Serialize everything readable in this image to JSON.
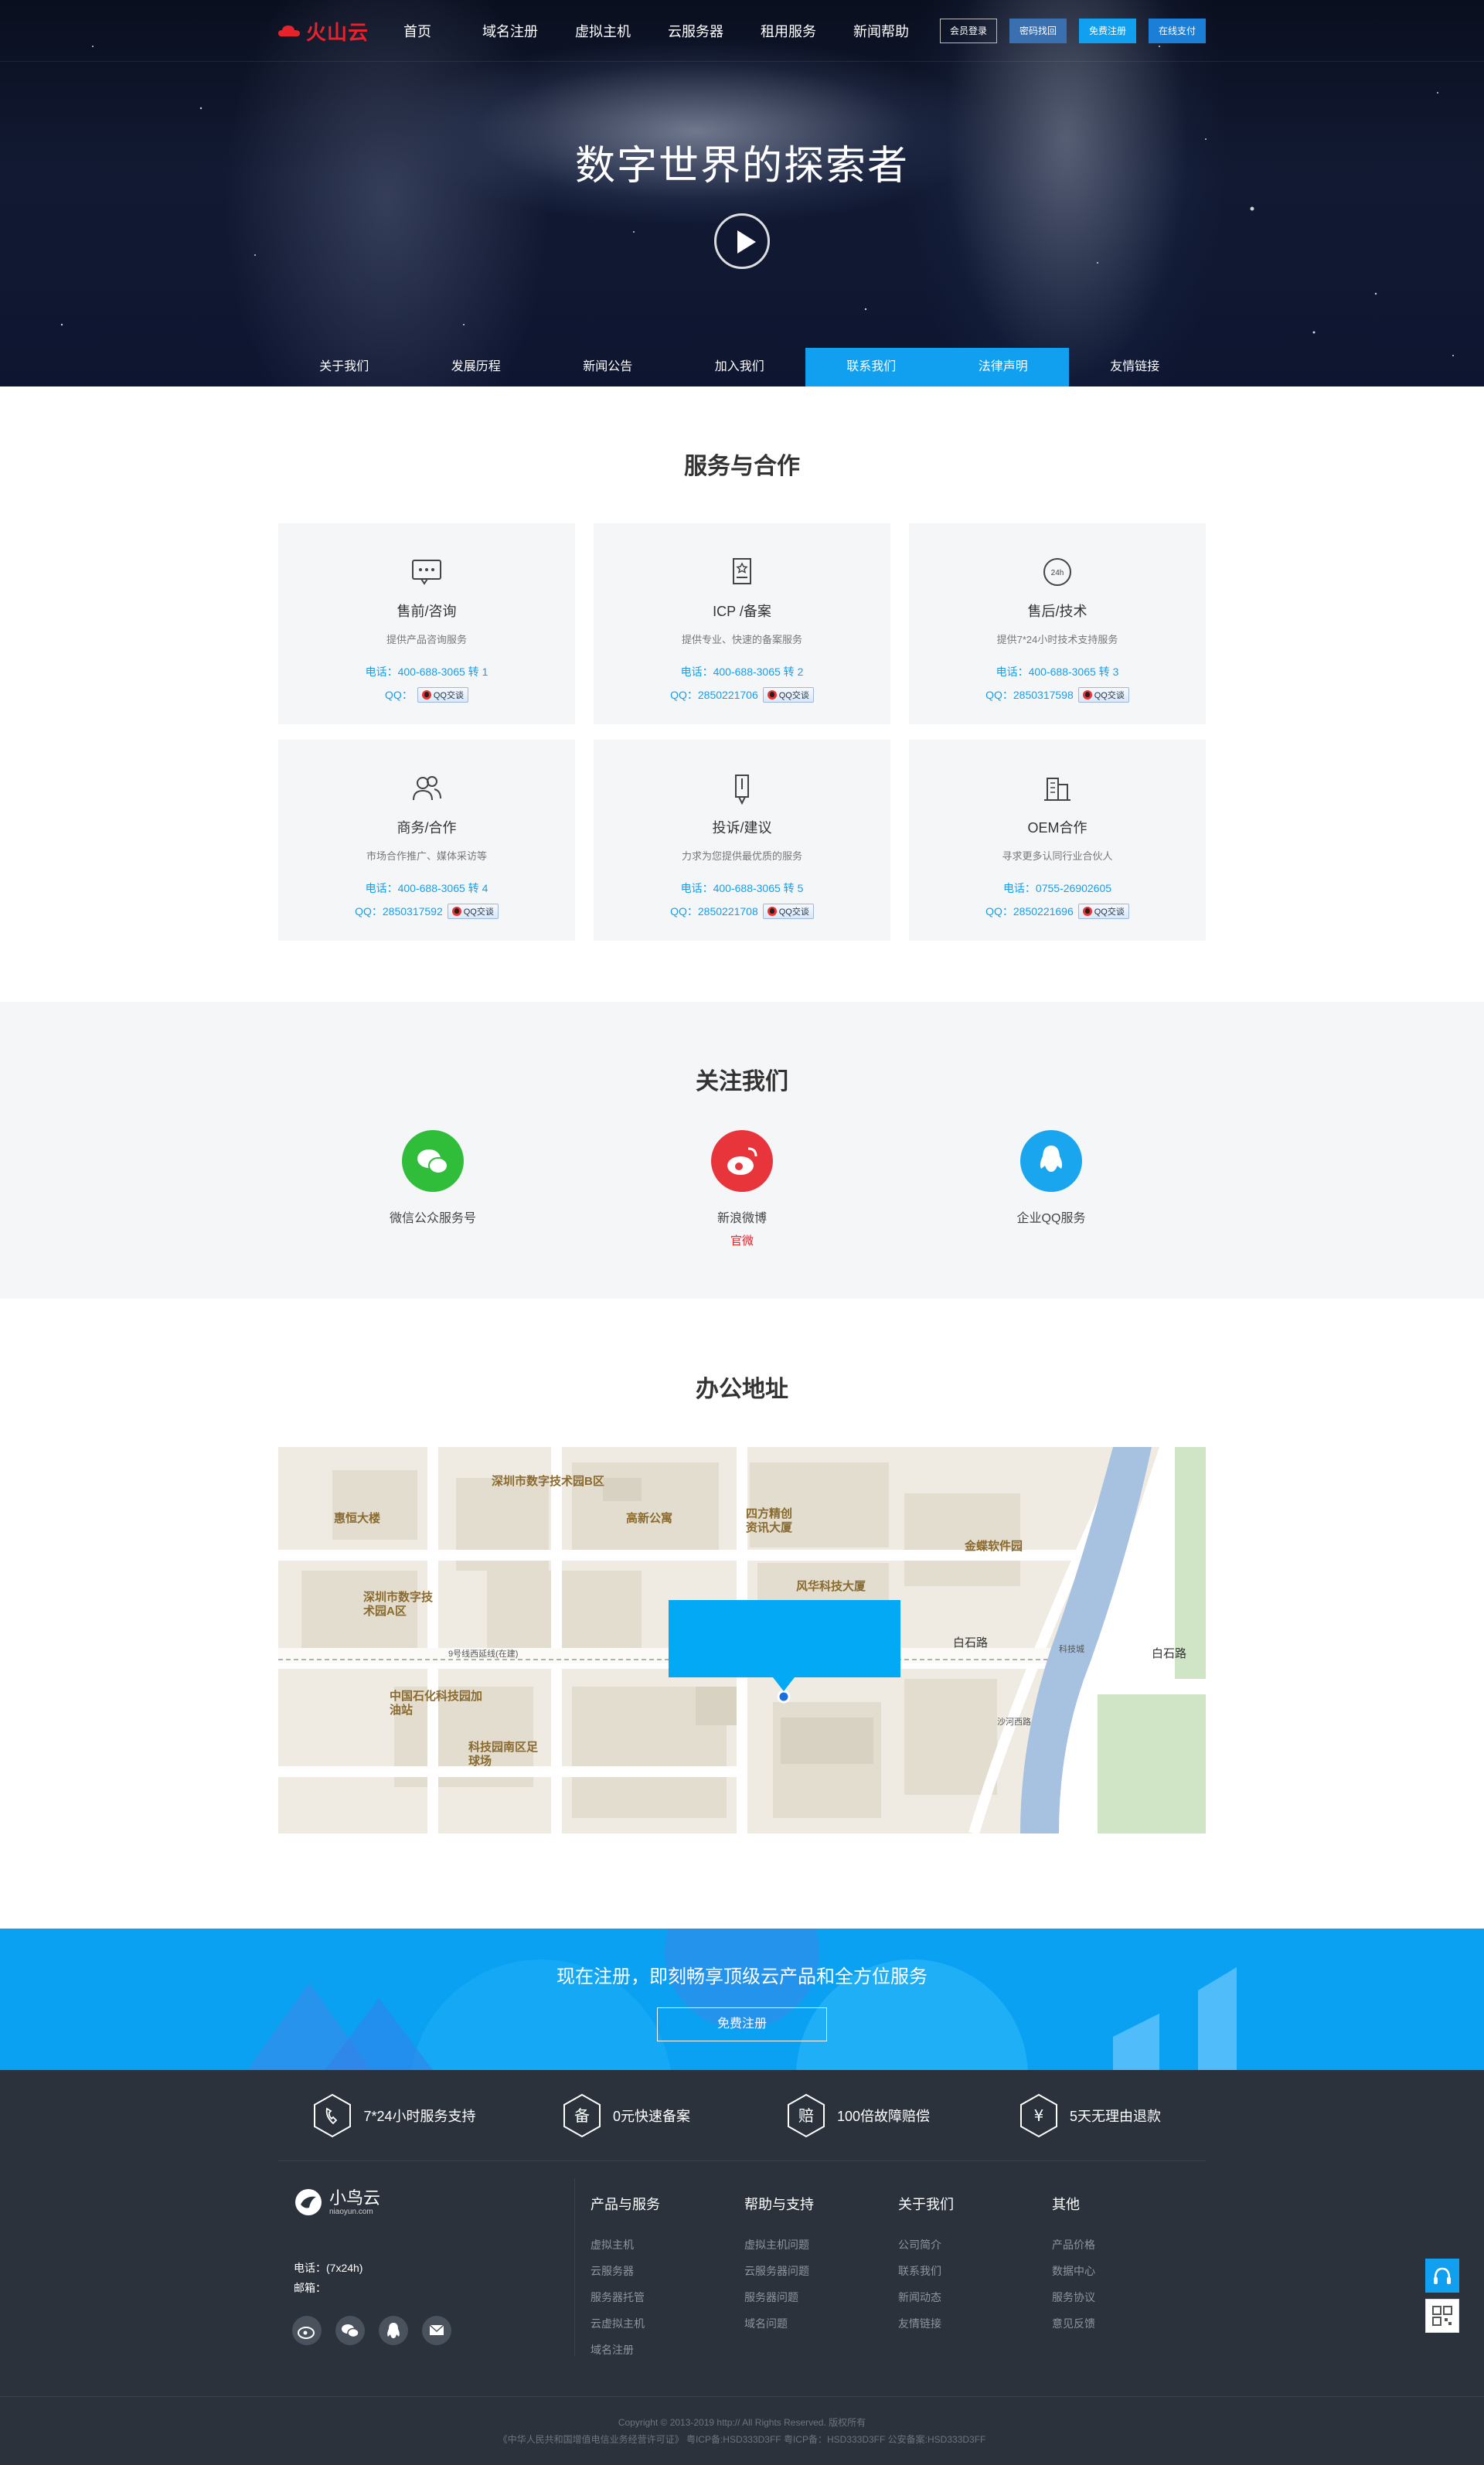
{
  "header": {
    "logo_text": "火山云",
    "nav": [
      "首页",
      "域名注册",
      "虚拟主机",
      "云服务器",
      "租用服务",
      "新闻帮助"
    ],
    "buttons": {
      "login": "会员登录",
      "find_password": "密码找回",
      "register": "免费注册",
      "pay": "在线支付"
    }
  },
  "hero": {
    "title": "数字世界的探索者",
    "subnav": [
      "关于我们",
      "发展历程",
      "新闻公告",
      "加入我们",
      "联系我们",
      "法律声明",
      "友情链接"
    ],
    "active_subnav": [
      "联系我们",
      "法律声明"
    ]
  },
  "service": {
    "title": "服务与合作",
    "qq_button": "QQ交谈",
    "cards": [
      {
        "icon": "chat-bubble-icon",
        "name": "售前/咨询",
        "desc": "提供产品咨询服务",
        "phone": "电话：400-688-3065 转 1",
        "qq_prefix": "QQ："
      },
      {
        "icon": "certificate-icon",
        "name": "ICP /备案",
        "desc": "提供专业、快速的备案服务",
        "phone": "电话：400-688-3065 转 2",
        "qq_prefix": "QQ：2850221706"
      },
      {
        "icon": "24h-clock-icon",
        "name": "售后/技术",
        "desc": "提供7*24小时技术支持服务",
        "phone": "电话：400-688-3065 转 3",
        "qq_prefix": "QQ：2850317598"
      },
      {
        "icon": "users-icon",
        "name": "商务/合作",
        "desc": "市场合作推广、媒体采访等",
        "phone": "电话：400-688-3065 转 4",
        "qq_prefix": "QQ：2850317592"
      },
      {
        "icon": "pen-icon",
        "name": "投诉/建议",
        "desc": "力求为您提供最优质的服务",
        "phone": "电话：400-688-3065 转 5",
        "qq_prefix": "QQ：2850221708"
      },
      {
        "icon": "building-icon",
        "name": "OEM合作",
        "desc": "寻求更多认同行业合伙人",
        "phone": "电话：0755-26902605",
        "qq_prefix": "QQ：2850221696"
      }
    ]
  },
  "follow": {
    "title": "关注我们",
    "items": [
      {
        "icon": "wechat-icon",
        "label": "微信公众服务号",
        "sub": "",
        "color": "#2fbd3a"
      },
      {
        "icon": "weibo-icon",
        "label": "新浪微博",
        "sub": "官微",
        "color": "#e8353b"
      },
      {
        "icon": "qq-icon",
        "label": "企业QQ服务",
        "sub": "",
        "color": "#1aa6ee"
      }
    ]
  },
  "office": {
    "title": "办公地址",
    "map_labels": {
      "a": "深圳市数字技术园B区",
      "b": "高新公寓",
      "c": "四方精创资讯大厦",
      "d": "惠恒大楼",
      "e": "金蝶软件园",
      "f": "深圳市数字技术园A区",
      "g": "风华科技大厦",
      "h": "中国石化科技园加油站",
      "i": "科技园南区足球场",
      "j": "白石路",
      "k": "白石路",
      "l": "9号线西延线(在建)",
      "m": "科技城",
      "n": "沙河西路"
    }
  },
  "cta": {
    "title": "现在注册，即刻畅享顶级云产品和全方位服务",
    "button": "免费注册"
  },
  "footer": {
    "guarantees": [
      {
        "icon": "phone-icon",
        "glyph": "",
        "text": "7*24小时服务支持"
      },
      {
        "icon": "record-icon",
        "glyph": "备",
        "text": "0元快速备案"
      },
      {
        "icon": "compensation-icon",
        "glyph": "赔",
        "text": "100倍故障赔偿"
      },
      {
        "icon": "yen-icon",
        "glyph": "¥",
        "text": "5天无理由退款"
      }
    ],
    "brand_name": "小鸟云",
    "brand_domain": "niaoyun.com",
    "phone_label": "电话：(7x24h)",
    "email_label": "邮箱：",
    "columns": [
      {
        "title": "产品与服务",
        "links": [
          "虚拟主机",
          "云服务器",
          "服务器托管",
          "云虚拟主机",
          "域名注册"
        ]
      },
      {
        "title": "帮助与支持",
        "links": [
          "虚拟主机问题",
          "云服务器问题",
          "服务器问题",
          "域名问题"
        ]
      },
      {
        "title": "关于我们",
        "links": [
          "公司简介",
          "联系我们",
          "新闻动态",
          "友情链接"
        ]
      },
      {
        "title": "其他",
        "links": [
          "产品价格",
          "数据中心",
          "服务协议",
          "意见反馈"
        ]
      }
    ],
    "copyright": "Copyright © 2013-2019   http://   All Rights Reserved. 版权所有",
    "license": "《中华人民共和国增值电信业务经营许可证》 粤ICP备:HSD333D3FF     粤ICP备：HSD333D3FF 公安备案:HSD333D3FF"
  },
  "colors": {
    "accent": "#11a0ef",
    "brand_red": "#e8222b",
    "footer_bg": "#2b323c",
    "card_bg": "#f5f6f8",
    "map_pop": "#03a9f4"
  }
}
